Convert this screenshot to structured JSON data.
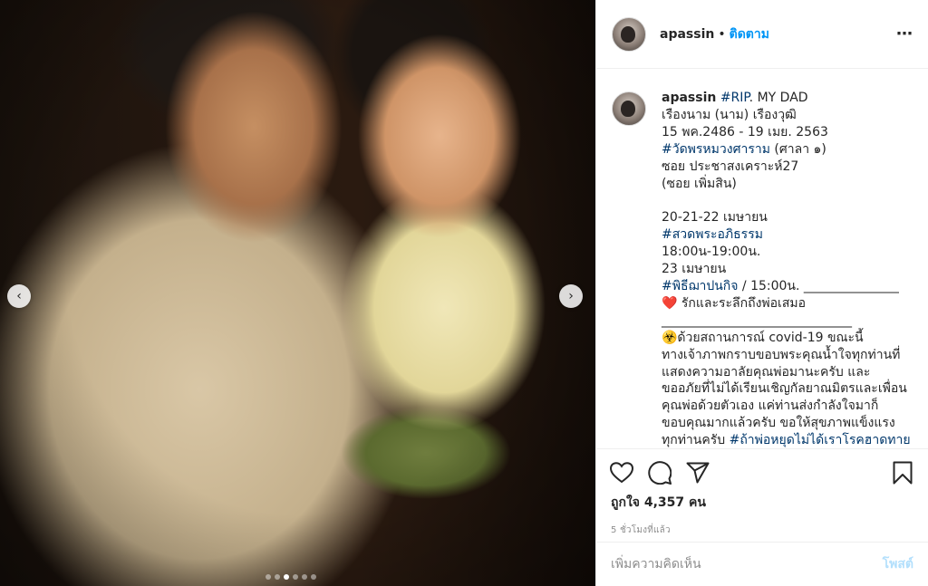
{
  "header": {
    "username": "apassin",
    "separator": "•",
    "follow_label": "ติดตาม",
    "more_icon": "⋯"
  },
  "caption": {
    "username": "apassin",
    "lines": [
      {
        "parts": [
          {
            "t": "#RIP",
            "tag": true
          },
          {
            "t": ". MY DAD",
            "tag": false
          }
        ]
      },
      {
        "parts": [
          {
            "t": "เรืองนาม (นาม) เรืองวุฒิ",
            "tag": false
          }
        ]
      },
      {
        "parts": [
          {
            "t": "15 พค.2486 - 19 เมย. 2563",
            "tag": false
          }
        ]
      },
      {
        "parts": [
          {
            "t": "#วัดพรหมวงศาราม",
            "tag": true
          },
          {
            "t": " (ศาลา ๑)",
            "tag": false
          }
        ]
      },
      {
        "parts": [
          {
            "t": "ซอย ประชาสงเคราะห์27",
            "tag": false
          }
        ]
      },
      {
        "parts": [
          {
            "t": "(ซอย เพิ่มสิน)",
            "tag": false
          }
        ]
      },
      {
        "parts": [
          {
            "t": " ",
            "tag": false
          }
        ]
      },
      {
        "parts": [
          {
            "t": "20-21-22 เมษายน",
            "tag": false
          }
        ]
      },
      {
        "parts": [
          {
            "t": "#สวดพระอภิธรรม",
            "tag": true
          }
        ]
      },
      {
        "parts": [
          {
            "t": "18:00น-19:00น.",
            "tag": false
          }
        ]
      },
      {
        "parts": [
          {
            "t": "23 เมษายน",
            "tag": false
          }
        ]
      },
      {
        "parts": [
          {
            "t": "#พิธีฌาปนกิจ",
            "tag": true
          },
          {
            "t": " / 15:00น. _______________",
            "tag": false
          }
        ]
      },
      {
        "parts": [
          {
            "t": "❤️ รักและระลึกถึงพ่อเสมอ",
            "tag": false
          }
        ]
      },
      {
        "parts": [
          {
            "t": "______________________________",
            "tag": false
          }
        ]
      },
      {
        "parts": [
          {
            "t": "☣️ด้วยสถานการณ์ covid-19 ขณะนี้",
            "tag": false
          }
        ]
      },
      {
        "parts": [
          {
            "t": "ทางเจ้าภาพกราบขอบพระคุณน้ำใจทุกท่านที่",
            "tag": false
          }
        ]
      },
      {
        "parts": [
          {
            "t": "แสดงความอาลัยคุณพ่อมานะครับ และ",
            "tag": false
          }
        ]
      },
      {
        "parts": [
          {
            "t": "ขออภัยที่ไม่ได้เรียนเชิญกัลยาณมิตรและเพื่อน",
            "tag": false
          }
        ]
      },
      {
        "parts": [
          {
            "t": "คุณพ่อด้วยตัวเอง แค่ท่านส่งกำลังใจมาก็",
            "tag": false
          }
        ]
      },
      {
        "parts": [
          {
            "t": "ขอบคุณมากแล้วครับ ขอให้สุขภาพแข็งแรง",
            "tag": false
          }
        ]
      },
      {
        "parts": [
          {
            "t": "ทุกท่านครับ ",
            "tag": false
          },
          {
            "t": "#ถ้าพ่อหยุดไม่ได้เราโรคฮาดทาย",
            "tag": true
          }
        ]
      }
    ]
  },
  "actions": {
    "like_icon": "heart-icon",
    "comment_icon": "comment-icon",
    "share_icon": "share-icon",
    "save_icon": "bookmark-icon"
  },
  "likes_text": "ถูกใจ 4,357 คน",
  "time_text": "5 ชั่วโมงที่แล้ว",
  "comment_box": {
    "placeholder": "เพิ่มความคิดเห็น",
    "post_label": "โพสต์"
  },
  "carousel": {
    "prev": "‹",
    "next": "›",
    "count": 6,
    "active_index": 2
  },
  "colors": {
    "link": "#00376b",
    "follow": "#0095f6",
    "post_disabled": "#b2dffc"
  }
}
